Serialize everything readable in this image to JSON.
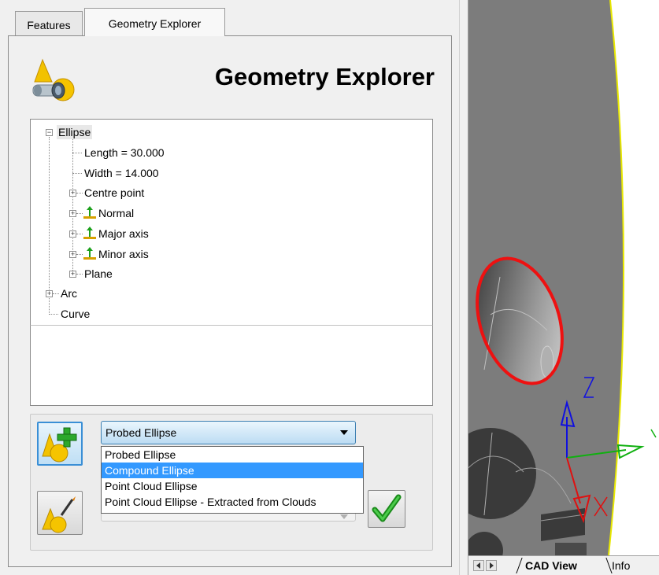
{
  "tabs": [
    {
      "label": "Features"
    },
    {
      "label": "Geometry Explorer"
    }
  ],
  "header": {
    "title": "Geometry Explorer"
  },
  "tree": {
    "ellipse": {
      "label": "Ellipse",
      "children": {
        "length": "Length = 30.000",
        "width": "Width = 14.000",
        "centre_point": "Centre point",
        "normal": "Normal",
        "major_axis": "Major axis",
        "minor_axis": "Minor axis",
        "plane": "Plane"
      }
    },
    "arc": "Arc",
    "curve": "Curve"
  },
  "feature_select": {
    "selected": "Probed Ellipse",
    "options": [
      "Probed Ellipse",
      "Compound Ellipse",
      "Point Cloud Ellipse",
      "Point Cloud Ellipse - Extracted from Clouds"
    ],
    "highlighted_index": 1
  },
  "cad": {
    "axis_labels": {
      "z": "Z",
      "x": "X",
      "y": "Y"
    },
    "colors": {
      "highlight": "#ee1111",
      "x_axis": "#e01010",
      "y_axis": "#10b010",
      "z_axis": "#1010e0",
      "surface": "#7c7c7c",
      "edge": "#e8e800"
    }
  },
  "view_tabs": {
    "cad_view": "CAD View",
    "info": "Info"
  },
  "icons": {
    "logo": "geometry-explorer-icon",
    "add": "add-feature-icon",
    "edit": "edit-feature-icon",
    "ok": "checkmark-icon"
  }
}
